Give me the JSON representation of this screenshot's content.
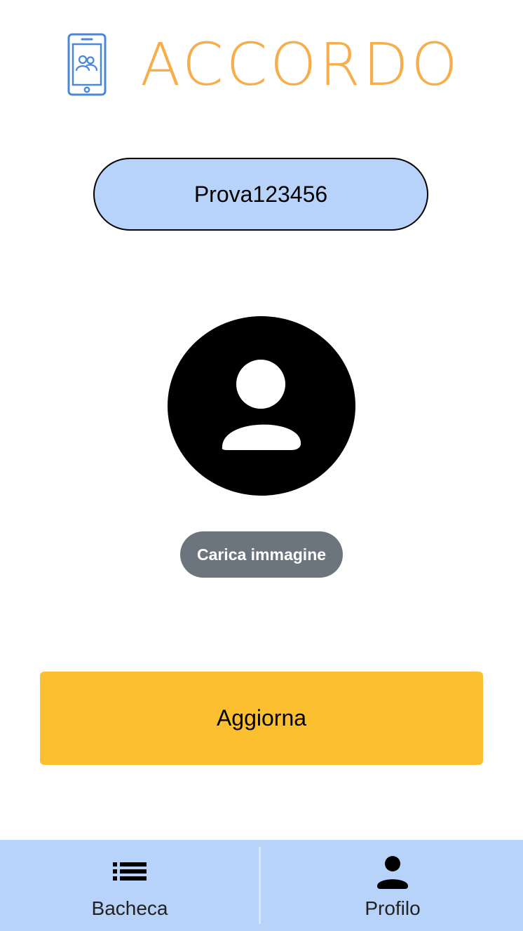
{
  "app": {
    "brand_name": "ACCORDO",
    "logo_icon": "phone-users-icon",
    "brand_color": "#f7ae4a",
    "icon_color": "#4a86d9"
  },
  "profile": {
    "username": "Prova123456",
    "avatar_icon": "user-avatar-icon",
    "upload_label": "Carica immagine",
    "update_label": "Aggiorna"
  },
  "bottom_nav": {
    "items": [
      {
        "label": "Bacheca",
        "icon": "list-icon"
      },
      {
        "label": "Profilo",
        "icon": "user-icon"
      }
    ]
  },
  "colors": {
    "pill_bg": "#b8d3fa",
    "upload_bg": "#6c757d",
    "update_bg": "#fcbf30",
    "nav_bg": "#b8d3fa"
  }
}
